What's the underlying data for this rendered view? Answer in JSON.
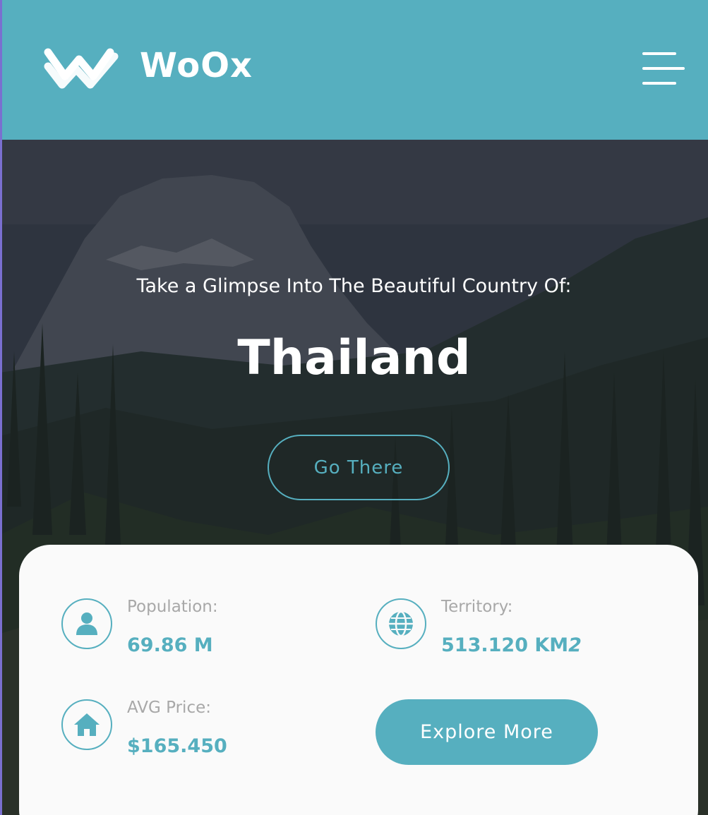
{
  "brand": {
    "name": "WoOx",
    "logo_icon": "woox-logo-icon"
  },
  "header": {
    "menu_icon": "hamburger-menu-icon"
  },
  "hero": {
    "subtitle": "Take a Glimpse Into The Beautiful Country Of:",
    "title": "Thailand",
    "cta_label": "Go There"
  },
  "stats": {
    "population": {
      "label": "Population:",
      "value": "69.86 M",
      "icon": "user-icon"
    },
    "territory": {
      "label": "Territory:",
      "value": "513.120 KM",
      "value_suffix": "2",
      "icon": "globe-icon"
    },
    "avg_price": {
      "label": "AVG Price:",
      "value": "$165.450",
      "icon": "home-icon"
    },
    "explore_label": "Explore More"
  },
  "colors": {
    "accent": "#56afbf",
    "card_bg": "#fafafa",
    "label_gray": "#a8a8a8",
    "white": "#ffffff"
  }
}
